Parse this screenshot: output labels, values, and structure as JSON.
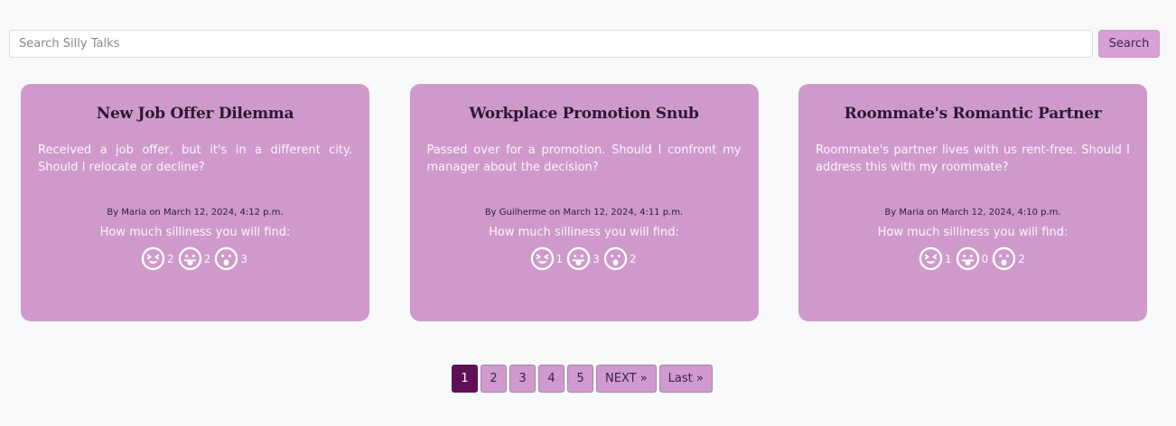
{
  "search": {
    "placeholder": "Search Silly Talks",
    "button_label": "Search"
  },
  "cards": [
    {
      "title": "New Job Offer Dilemma",
      "body": "Received a job offer, but it's in a different city. Should I relocate or decline?",
      "meta": "By Maria on March 12, 2024, 4:12 p.m.",
      "silly_label": "How much silliness you will find:",
      "reactions": [
        {
          "icon": "laughing-face-icon",
          "count": "2"
        },
        {
          "icon": "tongue-face-icon",
          "count": "2"
        },
        {
          "icon": "surprised-face-icon",
          "count": "3"
        }
      ]
    },
    {
      "title": "Workplace Promotion Snub",
      "body": "Passed over for a promotion. Should I confront my manager about the decision?",
      "meta": "By Guilherme on March 12, 2024, 4:11 p.m.",
      "silly_label": "How much silliness you will find:",
      "reactions": [
        {
          "icon": "laughing-face-icon",
          "count": "1"
        },
        {
          "icon": "tongue-face-icon",
          "count": "3"
        },
        {
          "icon": "surprised-face-icon",
          "count": "2"
        }
      ]
    },
    {
      "title": "Roommate's Romantic Partner",
      "body": "Roommate's partner lives with us rent-free. Should I address this with my roommate?",
      "meta": "By Maria on March 12, 2024, 4:10 p.m.",
      "silly_label": "How much silliness you will find:",
      "reactions": [
        {
          "icon": "laughing-face-icon",
          "count": "1"
        },
        {
          "icon": "tongue-face-icon",
          "count": "0"
        },
        {
          "icon": "surprised-face-icon",
          "count": "2"
        }
      ]
    }
  ],
  "pagination": {
    "pages": [
      "1",
      "2",
      "3",
      "4",
      "5"
    ],
    "current": "1",
    "next_label": "NEXT »",
    "last_label": "Last »"
  },
  "colors": {
    "card_bg": "#cf99cc",
    "active_page": "#5e1158",
    "button_bg": "#d7a0d6"
  }
}
